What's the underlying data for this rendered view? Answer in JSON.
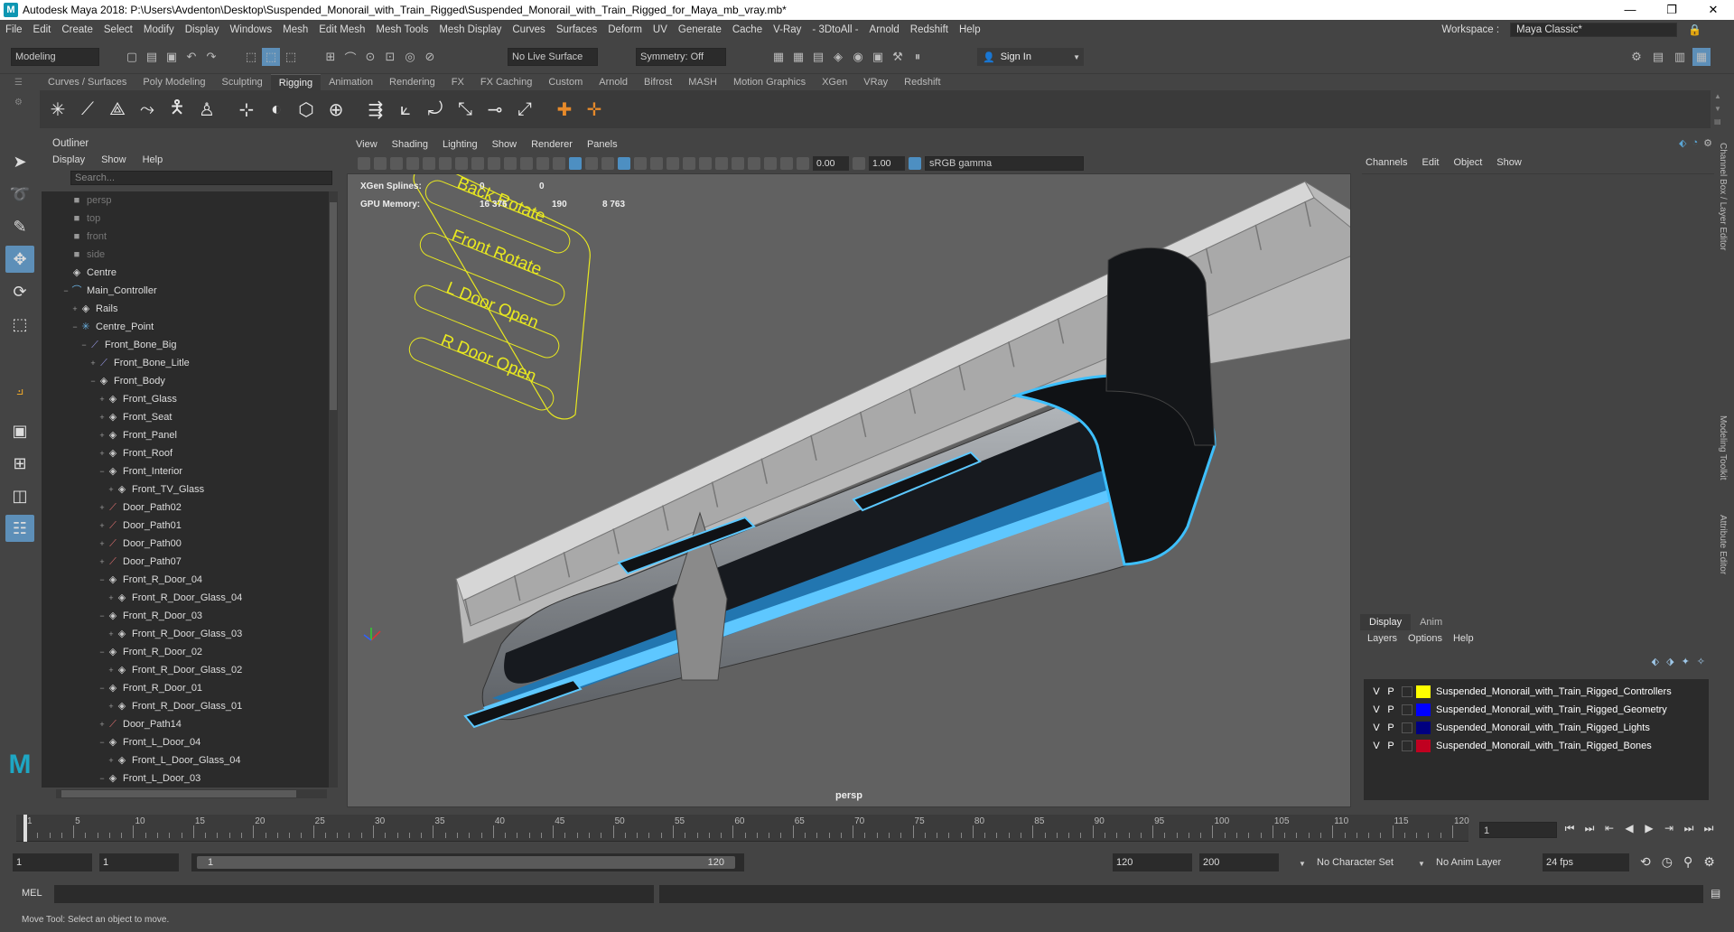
{
  "title": "Autodesk Maya 2018: P:\\Users\\Avdenton\\Desktop\\Suspended_Monorail_with_Train_Rigged\\Suspended_Monorail_with_Train_Rigged_for_Maya_mb_vray.mb*",
  "menus": [
    "File",
    "Edit",
    "Create",
    "Select",
    "Modify",
    "Display",
    "Windows",
    "Mesh",
    "Edit Mesh",
    "Mesh Tools",
    "Mesh Display",
    "Curves",
    "Surfaces",
    "Deform",
    "UV",
    "Generate",
    "Cache",
    "V-Ray",
    "- 3DtoAll -",
    "Arnold",
    "Redshift",
    "Help"
  ],
  "workspace": {
    "label": "Workspace :",
    "value": "Maya Classic*"
  },
  "statusline": {
    "mode": "Modeling",
    "live_surface": "No Live Surface",
    "symmetry": "Symmetry: Off",
    "sign_in": "Sign In"
  },
  "shelf_tabs": [
    "Curves / Surfaces",
    "Poly Modeling",
    "Sculpting",
    "Rigging",
    "Animation",
    "Rendering",
    "FX",
    "FX Caching",
    "Custom",
    "Arnold",
    "Bifrost",
    "MASH",
    "Motion Graphics",
    "XGen",
    "VRay",
    "Redshift"
  ],
  "active_shelf": "Rigging",
  "outliner": {
    "title": "Outliner",
    "menu": [
      "Display",
      "Show",
      "Help"
    ],
    "search_placeholder": "Search...",
    "items": [
      {
        "label": "persp",
        "depth": 1,
        "icon": "camera-icon",
        "dim": true,
        "exp": ""
      },
      {
        "label": "top",
        "depth": 1,
        "icon": "camera-icon",
        "dim": true,
        "exp": ""
      },
      {
        "label": "front",
        "depth": 1,
        "icon": "camera-icon",
        "dim": true,
        "exp": ""
      },
      {
        "label": "side",
        "depth": 1,
        "icon": "camera-icon",
        "dim": true,
        "exp": ""
      },
      {
        "label": "Centre",
        "depth": 1,
        "icon": "transform-icon",
        "dim": false,
        "exp": ""
      },
      {
        "label": "Main_Controller",
        "depth": 1,
        "icon": "curve-icon",
        "dim": false,
        "exp": "−"
      },
      {
        "label": "Rails",
        "depth": 2,
        "icon": "transform-icon",
        "dim": false,
        "exp": "+"
      },
      {
        "label": "Centre_Point",
        "depth": 2,
        "icon": "locator-icon",
        "dim": false,
        "exp": "−"
      },
      {
        "label": "Front_Bone_Big",
        "depth": 3,
        "icon": "joint-icon",
        "dim": false,
        "exp": "−"
      },
      {
        "label": "Front_Bone_Litle",
        "depth": 4,
        "icon": "joint-icon",
        "dim": false,
        "exp": "+"
      },
      {
        "label": "Front_Body",
        "depth": 4,
        "icon": "transform-icon",
        "dim": false,
        "exp": "−"
      },
      {
        "label": "Front_Glass",
        "depth": 5,
        "icon": "transform-icon",
        "dim": false,
        "exp": "+"
      },
      {
        "label": "Front_Seat",
        "depth": 5,
        "icon": "transform-icon",
        "dim": false,
        "exp": "+"
      },
      {
        "label": "Front_Panel",
        "depth": 5,
        "icon": "transform-icon",
        "dim": false,
        "exp": "+"
      },
      {
        "label": "Front_Roof",
        "depth": 5,
        "icon": "transform-icon",
        "dim": false,
        "exp": "+"
      },
      {
        "label": "Front_Interior",
        "depth": 5,
        "icon": "transform-icon",
        "dim": false,
        "exp": "−"
      },
      {
        "label": "Front_TV_Glass",
        "depth": 6,
        "icon": "transform-icon",
        "dim": false,
        "exp": "+"
      },
      {
        "label": "Door_Path02",
        "depth": 5,
        "icon": "path-icon",
        "dim": false,
        "exp": "+"
      },
      {
        "label": "Door_Path01",
        "depth": 5,
        "icon": "path-icon",
        "dim": false,
        "exp": "+"
      },
      {
        "label": "Door_Path00",
        "depth": 5,
        "icon": "path-icon",
        "dim": false,
        "exp": "+"
      },
      {
        "label": "Door_Path07",
        "depth": 5,
        "icon": "path-icon",
        "dim": false,
        "exp": "+"
      },
      {
        "label": "Front_R_Door_04",
        "depth": 5,
        "icon": "transform-icon",
        "dim": false,
        "exp": "−"
      },
      {
        "label": "Front_R_Door_Glass_04",
        "depth": 6,
        "icon": "transform-icon",
        "dim": false,
        "exp": "+"
      },
      {
        "label": "Front_R_Door_03",
        "depth": 5,
        "icon": "transform-icon",
        "dim": false,
        "exp": "−"
      },
      {
        "label": "Front_R_Door_Glass_03",
        "depth": 6,
        "icon": "transform-icon",
        "dim": false,
        "exp": "+"
      },
      {
        "label": "Front_R_Door_02",
        "depth": 5,
        "icon": "transform-icon",
        "dim": false,
        "exp": "−"
      },
      {
        "label": "Front_R_Door_Glass_02",
        "depth": 6,
        "icon": "transform-icon",
        "dim": false,
        "exp": "+"
      },
      {
        "label": "Front_R_Door_01",
        "depth": 5,
        "icon": "transform-icon",
        "dim": false,
        "exp": "−"
      },
      {
        "label": "Front_R_Door_Glass_01",
        "depth": 6,
        "icon": "transform-icon",
        "dim": false,
        "exp": "+"
      },
      {
        "label": "Door_Path14",
        "depth": 5,
        "icon": "path-icon",
        "dim": false,
        "exp": "+"
      },
      {
        "label": "Front_L_Door_04",
        "depth": 5,
        "icon": "transform-icon",
        "dim": false,
        "exp": "−"
      },
      {
        "label": "Front_L_Door_Glass_04",
        "depth": 6,
        "icon": "transform-icon",
        "dim": false,
        "exp": "+"
      },
      {
        "label": "Front_L_Door_03",
        "depth": 5,
        "icon": "transform-icon",
        "dim": false,
        "exp": "−"
      }
    ]
  },
  "viewport": {
    "menu": [
      "View",
      "Shading",
      "Lighting",
      "Show",
      "Renderer",
      "Panels"
    ],
    "exposure": "0.00",
    "gamma": "1.00",
    "colorspace": "sRGB gamma",
    "hud": {
      "xgen_label": "XGen Splines:",
      "xgen_a": "0",
      "xgen_b": "0",
      "gpu_label": "GPU Memory:",
      "gpu_a": "16 376",
      "gpu_b": "190",
      "gpu_c": "8 763"
    },
    "camera": "persp",
    "controller_labels": [
      "Back Rotate",
      "Front Rotate",
      "L Door Open",
      "R Door Open"
    ]
  },
  "channelbox": {
    "menu": [
      "Channels",
      "Edit",
      "Object",
      "Show"
    ]
  },
  "layers": {
    "tabs": [
      "Display",
      "Anim"
    ],
    "menu": [
      "Layers",
      "Options",
      "Help"
    ],
    "rows": [
      {
        "v": "V",
        "p": "P",
        "name": "Suspended_Monorail_with_Train_Rigged_Controllers",
        "color": "#ffff00"
      },
      {
        "v": "V",
        "p": "P",
        "name": "Suspended_Monorail_with_Train_Rigged_Geometry",
        "color": "#0000ff"
      },
      {
        "v": "V",
        "p": "P",
        "name": "Suspended_Monorail_with_Train_Rigged_Lights",
        "color": "#000080"
      },
      {
        "v": "V",
        "p": "P",
        "name": "Suspended_Monorail_with_Train_Rigged_Bones",
        "color": "#c00020"
      }
    ]
  },
  "side_tabs": [
    "Channel Box / Layer Editor",
    "Modeling Toolkit",
    "Attribute Editor"
  ],
  "timeline": {
    "ticks": [
      1,
      5,
      10,
      15,
      20,
      25,
      30,
      35,
      40,
      45,
      50,
      55,
      60,
      65,
      70,
      75,
      80,
      85,
      90,
      95,
      100,
      105,
      110,
      115,
      120
    ],
    "current_frame": "1"
  },
  "range": {
    "start": "1",
    "anim_start": "1",
    "slider_start": "1",
    "slider_end": "120",
    "end": "120",
    "anim_end": "200",
    "character_set": "No Character Set",
    "anim_layer": "No Anim Layer",
    "fps": "24 fps"
  },
  "command": {
    "label": "MEL"
  },
  "status": "Move Tool: Select an object to move."
}
